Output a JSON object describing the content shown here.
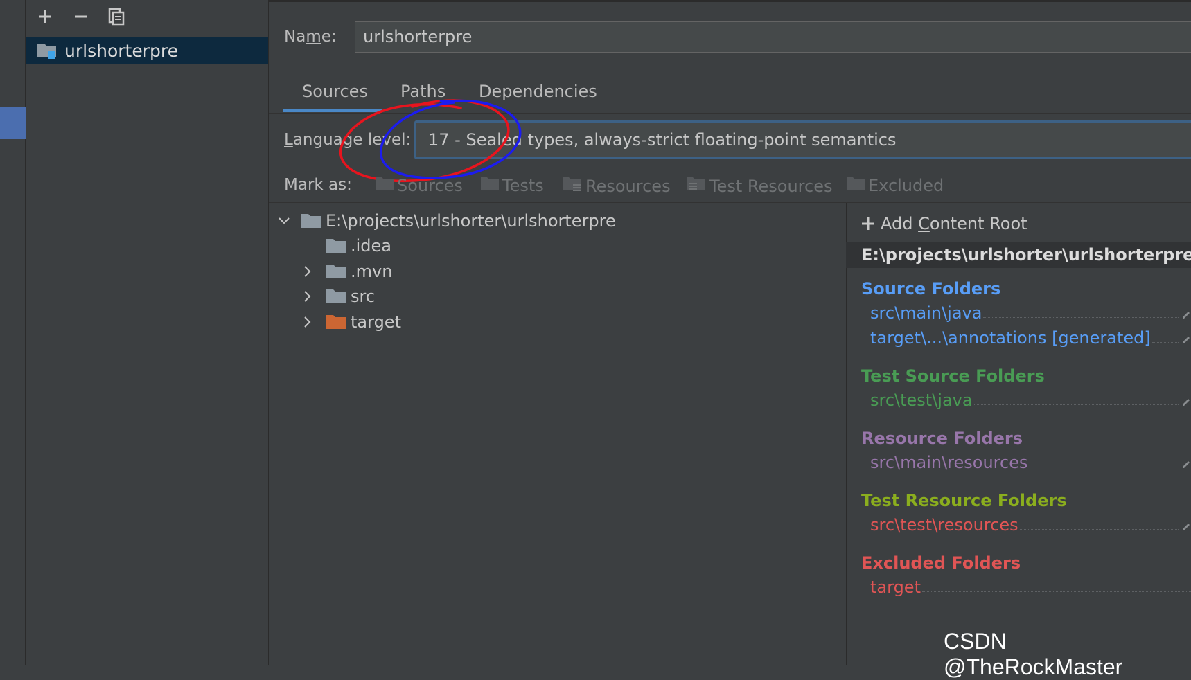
{
  "toolbar": {
    "add_icon": "plus-icon",
    "remove_icon": "minus-icon",
    "copy_icon": "copy-icon"
  },
  "modules": [
    {
      "name": "urlshorterpre",
      "icon": "module-folder-icon"
    }
  ],
  "name_field": {
    "label": "Name:",
    "value": "urlshorterpre"
  },
  "tabs": [
    {
      "label": "Sources",
      "selected": true
    },
    {
      "label": "Paths",
      "selected": false
    },
    {
      "label": "Dependencies",
      "selected": false
    }
  ],
  "language_level": {
    "label": "Language level:",
    "value": "17 - Sealed types, always-strict floating-point semantics"
  },
  "mark_as": {
    "label": "Mark as:",
    "items": [
      {
        "label": "Sources",
        "icon": "sources-folder-icon"
      },
      {
        "label": "Tests",
        "icon": "tests-folder-icon"
      },
      {
        "label": "Resources",
        "icon": "resources-folder-icon"
      },
      {
        "label": "Test Resources",
        "icon": "test-resources-folder-icon"
      },
      {
        "label": "Excluded",
        "icon": "excluded-folder-icon"
      }
    ]
  },
  "tree": [
    {
      "label": "E:\\projects\\urlshorter\\urlshorterpre",
      "expanded": true,
      "color": "#8f9aa3"
    },
    {
      "label": ".idea",
      "expandable": false,
      "color": "#8f9aa3"
    },
    {
      "label": ".mvn",
      "expandable": true,
      "color": "#8f9aa3"
    },
    {
      "label": "src",
      "expandable": true,
      "color": "#8f9aa3"
    },
    {
      "label": "target",
      "expandable": true,
      "color": "#cc6633"
    }
  ],
  "content_root": {
    "add_label": "Add Content Root",
    "path": "E:\\projects\\urlshorter\\urlshorterpre",
    "sections": [
      {
        "title": "Source Folders",
        "color": "#589df6",
        "entries": [
          "src\\main\\java",
          "target\\...\\annotations [generated]"
        ]
      },
      {
        "title": "Test Source Folders",
        "color": "#499c54",
        "entries": [
          "src\\test\\java"
        ]
      },
      {
        "title": "Resource Folders",
        "color": "#9876aa",
        "entries": [
          "src\\main\\resources"
        ]
      },
      {
        "title": "Test Resource Folders",
        "color": "#8bae1e",
        "entries": [
          "src\\test\\resources"
        ],
        "entry_color": "#e05555"
      },
      {
        "title": "Excluded Folders",
        "color": "#e05555",
        "entries": [
          "target"
        ]
      }
    ]
  },
  "watermark": "CSDN @TheRockMaster",
  "annotation_colors": {
    "red": "#e8141e",
    "blue": "#1c1cf0"
  }
}
